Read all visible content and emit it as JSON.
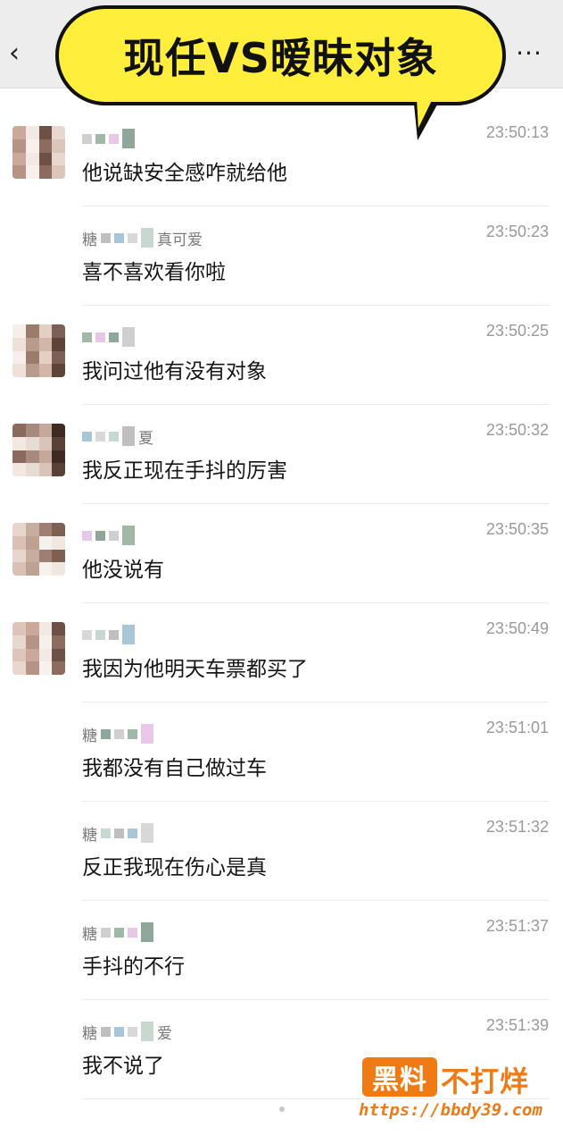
{
  "nav": {
    "back_icon": "‹",
    "more_icon": "···"
  },
  "banner": {
    "text": "现任VS暧昧对象"
  },
  "messages": [
    {
      "name": "",
      "time": "23:50:13",
      "text": "他说缺安全感咋就给他",
      "avatar": true
    },
    {
      "name": "糖",
      "name_suffix": "真可爱",
      "time": "23:50:23",
      "text": "喜不喜欢看你啦",
      "avatar": false
    },
    {
      "name": "",
      "time": "23:50:25",
      "text": "我问过他有没有对象",
      "avatar": true
    },
    {
      "name": "",
      "name_suffix": "夏",
      "time": "23:50:32",
      "text": "我反正现在手抖的厉害",
      "avatar": true
    },
    {
      "name": "",
      "time": "23:50:35",
      "text": "他没说有",
      "avatar": true
    },
    {
      "name": "",
      "time": "23:50:49",
      "text": "我因为他明天车票都买了",
      "avatar": true
    },
    {
      "name": "糖",
      "time": "23:51:01",
      "text": "我都没有自己做过车",
      "avatar": false
    },
    {
      "name": "糖",
      "time": "23:51:32",
      "text": "反正我现在伤心是真",
      "avatar": false
    },
    {
      "name": "糖",
      "time": "23:51:37",
      "text": "手抖的不行",
      "avatar": false
    },
    {
      "name": "糖",
      "name_suffix": "爱",
      "time": "23:51:39",
      "text": "我不说了",
      "avatar": false
    }
  ],
  "watermark": {
    "box": "黑料",
    "right": "不打烊",
    "url": "https://bbdy39.com"
  },
  "colors": {
    "banner": "#ffef3c",
    "nav_bg": "#ededed",
    "watermark": "#f07a14"
  }
}
